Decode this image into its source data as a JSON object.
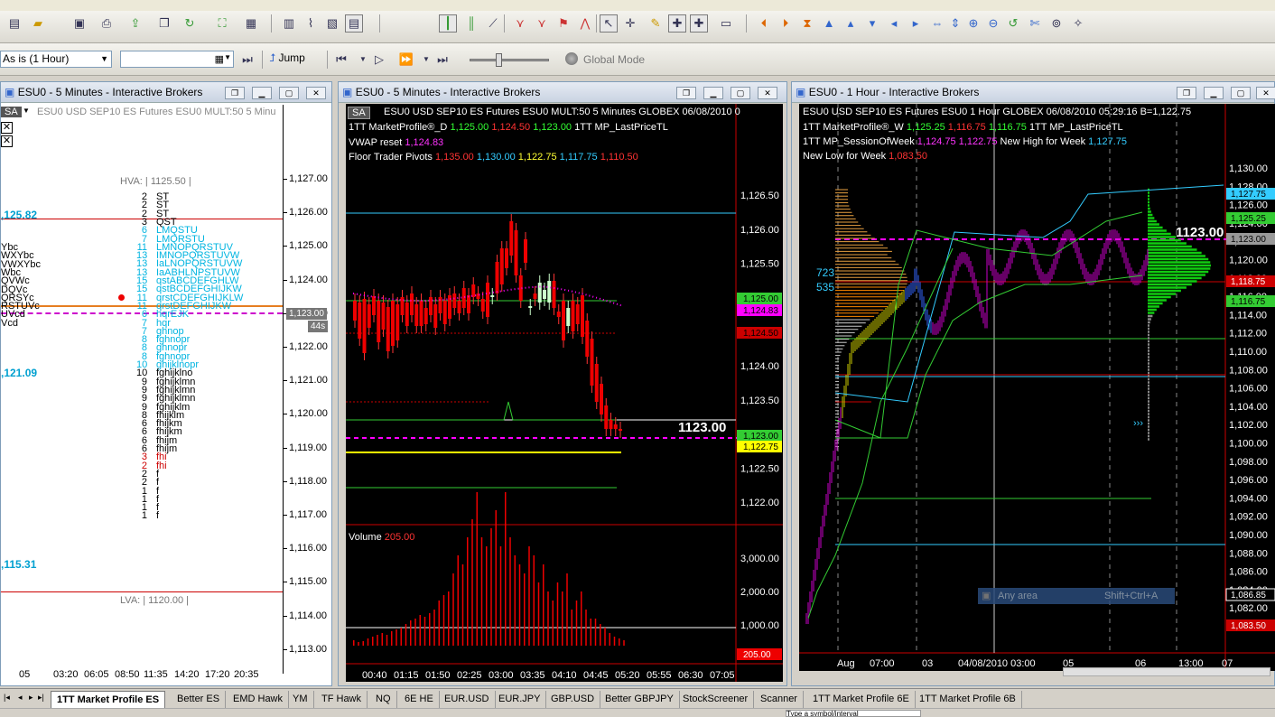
{
  "toolbar2": {
    "interval": "As is (1 Hour)",
    "jump": "Jump",
    "global_mode": "Global Mode"
  },
  "left": {
    "title": "ESU0 - 5 Minutes - Interactive Brokers",
    "sa": "SA",
    "header": "ESU0   USD SEP10 ES Futures ESU0 MULT:50  5 Minu",
    "hva": "HVA: | 1125.50 |",
    "lva": "LVA: | 1120.00 |",
    "prices": [
      "1,127.00",
      "1,126.00",
      "1,125.00",
      "1,124.00",
      "1,123.00",
      "1,122.00",
      "1,121.00",
      "1,120.00",
      "1,119.00",
      "1,118.00",
      "1,117.00",
      "1,116.00",
      "1,115.00",
      "1,114.00",
      "1,113.00"
    ],
    "cur_price": "1,123.00",
    "timer": "44s",
    "side_vals": [
      ",125.82",
      ",121.09",
      ",115.31"
    ],
    "side_letters": [
      "Ybc",
      "WXYbc",
      "VWXYbc",
      "Wbc",
      "QVWc",
      "DQVc",
      "QRSYc",
      "RSTUVc",
      "UVcd",
      "Vcd"
    ],
    "counts": [
      "2",
      "2",
      "2",
      "3",
      "6",
      "7",
      "11",
      "13",
      "13",
      "13",
      "15",
      "15",
      "11",
      "11",
      "6",
      "7",
      "7",
      "8",
      "8",
      "8",
      "10",
      "10",
      "9",
      "9",
      "9",
      "9",
      "8",
      "6",
      "6",
      "6",
      "6",
      "3",
      "2",
      "2",
      "2",
      "1",
      "1",
      "1",
      "1"
    ],
    "letters": [
      "ST",
      "ST",
      "ST",
      "QST",
      "LMQSTU",
      "LMQRSTU",
      "LMNOPQRSTUV",
      "IMNOPQRSTUVW",
      "IaLNOPQRSTUVW",
      "IaABHLNPSTUVW",
      "qstABCDEFGHLW",
      "qstBCDEFGHIJKW",
      "qrstCDEFGHIJKLW",
      "qrstDEFGHIJKW",
      "hqrEJK",
      "hqr",
      "ghnop",
      "fghnopr",
      "ghnopr",
      "fghnopr",
      "ghijklnopr",
      "fghijklno",
      "fghijklmn",
      "fghijklmn",
      "fghijklmn",
      "fghijklm",
      "fhijklm",
      "fhijkm",
      "fhijkm",
      "fhijm",
      "fhijm",
      "fhi",
      "fhi",
      "f",
      "f",
      "f",
      "f",
      "f",
      "f"
    ],
    "times": [
      "05",
      "03:20",
      "06:05",
      "08:50",
      "11:35",
      "14:20",
      "17:20",
      "20:35"
    ]
  },
  "mid": {
    "title": "ESU0 - 5 Minutes - Interactive Brokers",
    "sa": "SA",
    "header": "ESU0  USD SEP10 ES Futures ESU0 MULT:50  5 Minutes  GLOBEX  06/08/2010  0",
    "l1": "1TT MarketProfile®_D",
    "l1v": [
      "1,125.00",
      "1,124.50",
      "1,123.00"
    ],
    "l1b": "1TT MP_LastPriceTL",
    "l2": "VWAP reset",
    "l2v": "1,124.83",
    "l3": "Floor Trader Pivots",
    "l3v": [
      "1,135.00",
      "1,130.00",
      "1,122.75",
      "1,117.75",
      "1,110.50"
    ],
    "big_price": "1123.00",
    "prices": [
      "1,126.50",
      "1,126.00",
      "1,125.50",
      "1,125.00",
      "1,124.50",
      "1,124.00",
      "1,123.50",
      "1,123.00",
      "1,122.50",
      "1,122.00"
    ],
    "tags": [
      "1,125.00",
      "1,124.83",
      "1,124.50",
      "1,123.00",
      "1,122.75"
    ],
    "volume": "Volume",
    "volume_val": "205.00",
    "vol_axis": [
      "3,000.00",
      "2,000.00",
      "1,000.00"
    ],
    "vol_tag": "205.00",
    "times": [
      "00:40",
      "01:15",
      "01:50",
      "02:25",
      "03:00",
      "03:35",
      "04:10",
      "04:45",
      "05:20",
      "05:55",
      "06:30",
      "07:05"
    ]
  },
  "right": {
    "title": "ESU0 - 1 Hour - Interactive Brokers",
    "header": "ESU0  USD SEP10 ES Futures ESU0  1 Hour  GLOBEX  06/08/2010  05:29:16  B=1,122.75",
    "l1": "1TT MarketProfile®_W",
    "l1v": [
      "1,125.25",
      "1,116.75",
      "1,116.75"
    ],
    "l1b": "1TT MP_LastPriceTL",
    "l2": "1TT MP_SessionOfWeek",
    "l2v": [
      "1,124.75",
      "1,122.75"
    ],
    "l2b": "New High for Week",
    "l2bv": "1,127.75",
    "l3": "New Low for Week",
    "l3v": "1,083.50",
    "big_price": "1123.00",
    "n723": "723",
    "n535": "535",
    "prices": [
      "1,130.00",
      "1,128.00",
      "1,126.00",
      "1,124.00",
      "1,122.00",
      "1,120.00",
      "1,118.00",
      "1,116.00",
      "1,114.00",
      "1,112.00",
      "1,110.00",
      "1,108.00",
      "1,106.00",
      "1,104.00",
      "1,102.00",
      "1,100.00",
      "1,098.00",
      "1,096.00",
      "1,094.00",
      "1,092.00",
      "1,090.00",
      "1,088.00",
      "1,086.00",
      "1,084.00",
      "1,082.00"
    ],
    "tags": [
      "1,127.75",
      "1,125.25",
      "1,123.00",
      "1,118.75",
      "1,116.75",
      "1,086.85",
      "1,083.50"
    ],
    "any_area": "Any area",
    "shortcut": "Shift+Ctrl+A",
    "times": [
      "Aug",
      "07:00",
      "03",
      "04/08/2010 03:00",
      "05",
      "06",
      "13:00",
      "07"
    ],
    "arrows": "›››"
  },
  "tabs": [
    "1TT Market Profile ES",
    "Better ES",
    "EMD Hawk",
    "YM",
    "TF Hawk",
    "NQ",
    "6E HE",
    "EUR.USD",
    "EUR.JPY",
    "GBP.USD",
    "Better GBPJPY",
    "StockScreener",
    "Scanner",
    "1TT Market Profile 6E",
    "1TT Market Profile 6B"
  ],
  "symbol_box": "Type a symbol/interval"
}
